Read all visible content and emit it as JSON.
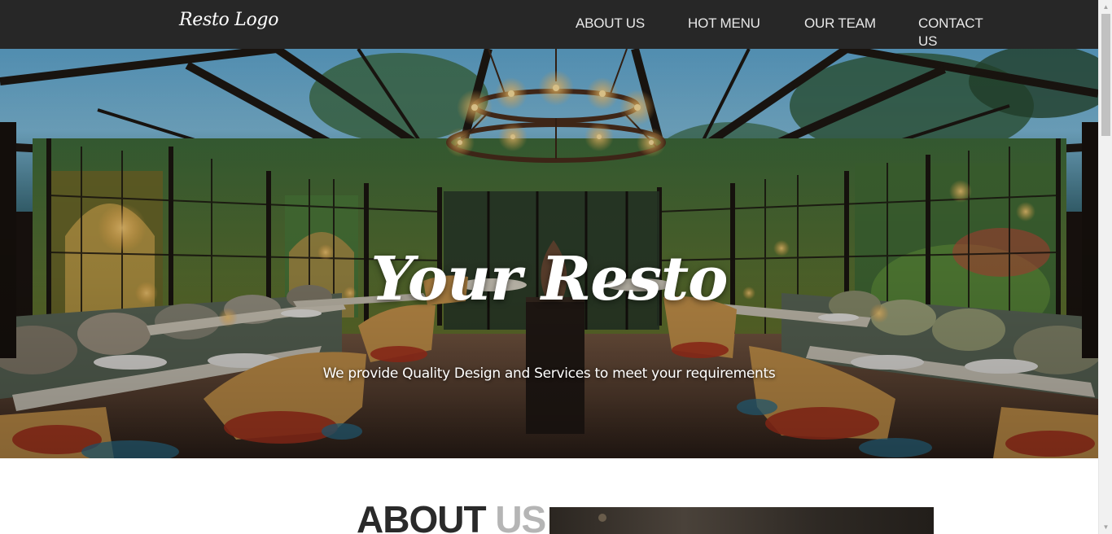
{
  "navbar": {
    "logo": "Resto Logo",
    "links": [
      {
        "label": "ABOUT US"
      },
      {
        "label": "HOT MENU"
      },
      {
        "label": "OUR TEAM"
      },
      {
        "label": "CONTACT US"
      }
    ]
  },
  "hero": {
    "title": "Your Resto",
    "subtitle": "We provide Quality Design and Services to meet your requirements",
    "image_icon": "restaurant-interior-photo"
  },
  "about": {
    "heading_part1": "ABOUT",
    "heading_part2": "US",
    "image_icon": "about-photo"
  },
  "colors": {
    "navbar_bg": "#272727",
    "nav_text": "#e8e8e8",
    "heading_dark": "#2a2a2a",
    "heading_light": "#b5b5b5"
  }
}
